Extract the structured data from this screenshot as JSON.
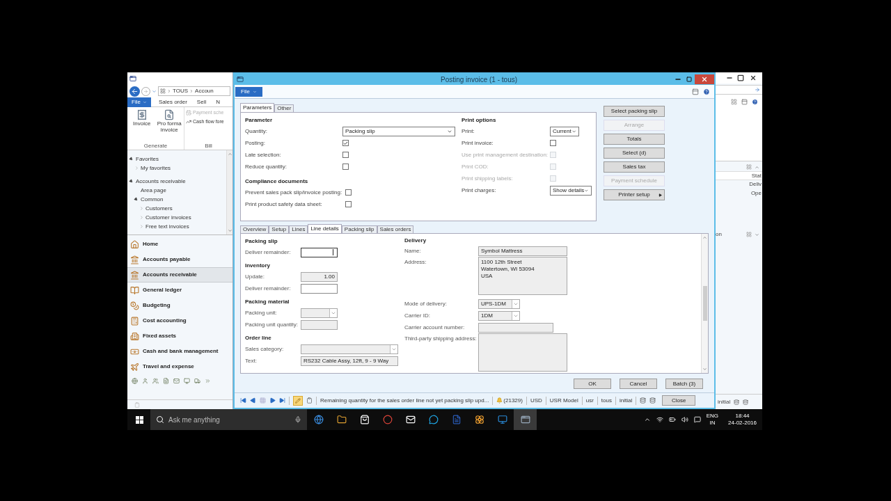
{
  "left_window": {
    "breadcrumb": [
      "TOUS",
      "Accoun"
    ],
    "file_menu": "File",
    "ribbon_tabs": [
      "Sales order",
      "Sell",
      "N"
    ],
    "generate_group": {
      "label": "Generate",
      "buttons": [
        "Invoice",
        "Pro forma invoice"
      ]
    },
    "bill_group": {
      "label": "Bill",
      "items": [
        {
          "label": "Payment sche",
          "disabled": true
        },
        {
          "label": "Cash flow fore",
          "disabled": false
        }
      ]
    },
    "nav_tree": [
      {
        "label": "Favorites",
        "expanded": true,
        "children": [
          {
            "label": "My favorites",
            "expanded": false
          }
        ]
      },
      {
        "label": "Accounts receivable",
        "expanded": true,
        "children": [
          {
            "label": "Area page"
          },
          {
            "label": "Common",
            "expanded": true,
            "children": [
              {
                "label": "Customers",
                "expanded": false
              },
              {
                "label": "Customer invoices",
                "expanded": false
              },
              {
                "label": "Free text invoices",
                "expanded": false
              }
            ]
          }
        ]
      }
    ],
    "modules": [
      {
        "label": "Home",
        "selected": false
      },
      {
        "label": "Accounts payable",
        "selected": false
      },
      {
        "label": "Accounts receivable",
        "selected": true
      },
      {
        "label": "General ledger",
        "selected": false
      },
      {
        "label": "Budgeting",
        "selected": false
      },
      {
        "label": "Cost accounting",
        "selected": false
      },
      {
        "label": "Fixed assets",
        "selected": false
      },
      {
        "label": "Cash and bank management",
        "selected": false
      },
      {
        "label": "Travel and expense",
        "selected": false
      }
    ]
  },
  "dialog": {
    "title": "Posting invoice (1 - tous)",
    "file_menu": "File",
    "top_tabs": [
      {
        "label": "Parameters",
        "selected": true
      },
      {
        "label": "Other",
        "selected": false
      }
    ],
    "parameter": {
      "heading": "Parameter",
      "fields": [
        {
          "kind": "dropdown",
          "label": "Quantity:",
          "value": "Packing slip"
        },
        {
          "kind": "checkbox",
          "label": "Posting:",
          "checked": true
        },
        {
          "kind": "checkbox",
          "label": "Late selection:",
          "checked": false
        },
        {
          "kind": "checkbox",
          "label": "Reduce quantity:",
          "checked": false
        }
      ]
    },
    "compliance": {
      "heading": "Compliance documents",
      "fields": [
        {
          "kind": "checkbox",
          "label": "Prevent sales pack slip/invoice posting:",
          "checked": false
        },
        {
          "kind": "checkbox",
          "label": "Print product safety data sheet:",
          "checked": false
        }
      ]
    },
    "print_options": {
      "heading": "Print options",
      "fields": [
        {
          "kind": "dropdown",
          "label": "Print:",
          "value": "Current"
        },
        {
          "kind": "checkbox",
          "label": "Print invoice:",
          "checked": false,
          "disabled": false
        },
        {
          "kind": "checkbox",
          "label": "Use print management destination:",
          "checked": false,
          "disabled": true
        },
        {
          "kind": "checkbox",
          "label": "Print COD:",
          "checked": false,
          "disabled": true
        },
        {
          "kind": "checkbox",
          "label": "Print shipping labels:",
          "checked": false,
          "disabled": true
        },
        {
          "kind": "dropdown",
          "label": "Print charges:",
          "value": "Show details"
        }
      ]
    },
    "actions": [
      {
        "label": "Select packing slip",
        "disabled": false,
        "submenu": false
      },
      {
        "label": "Arrange",
        "disabled": true,
        "submenu": false
      },
      {
        "label": "Totals",
        "disabled": false,
        "submenu": false
      },
      {
        "label": "Select (d)",
        "disabled": false,
        "submenu": false
      },
      {
        "label": "Sales tax",
        "disabled": false,
        "submenu": false
      },
      {
        "label": "Payment schedule",
        "disabled": true,
        "submenu": false
      },
      {
        "label": "Printer setup",
        "disabled": false,
        "submenu": true
      }
    ],
    "detail_tabs": [
      {
        "label": "Overview",
        "selected": false
      },
      {
        "label": "Setup",
        "selected": false
      },
      {
        "label": "Lines",
        "selected": false
      },
      {
        "label": "Line details",
        "selected": true
      },
      {
        "label": "Packing slip",
        "selected": false
      },
      {
        "label": "Sales orders",
        "selected": false
      }
    ],
    "line_details": {
      "sections": [
        {
          "heading": "Packing slip",
          "fields": [
            {
              "kind": "input",
              "label": "Deliver remainder:",
              "readonly": false,
              "focused": true
            }
          ]
        },
        {
          "heading": "Inventory",
          "fields": [
            {
              "kind": "number",
              "label": "Update:",
              "value": "1.00",
              "readonly": true
            },
            {
              "kind": "input",
              "label": "Deliver remainder:",
              "readonly": false,
              "focused": false
            }
          ]
        },
        {
          "heading": "Packing material",
          "fields": [
            {
              "kind": "dropdown",
              "label": "Packing unit:",
              "readonly": true
            },
            {
              "kind": "input",
              "label": "Packing unit quantity:",
              "readonly": true,
              "focused": false
            }
          ]
        },
        {
          "heading": "Order line",
          "fields": [
            {
              "kind": "dropdown",
              "label": "Sales category:",
              "readonly": true,
              "wide": true
            },
            {
              "kind": "input",
              "label": "Text:",
              "value": "RS232 Cable Assy, 12ft, 9 - 9 Way",
              "readonly": true,
              "focused": false,
              "wide": true
            }
          ]
        }
      ]
    },
    "delivery": {
      "heading": "Delivery",
      "fields": [
        {
          "kind": "input",
          "label": "Name:",
          "value": "Symbol Mattress",
          "readonly": true,
          "focused": false
        },
        {
          "kind": "textarea",
          "label": "Address:",
          "lines": [
            "1100 12th Street",
            "Watertown, WI 53094",
            "USA"
          ]
        },
        {
          "kind": "dropdown",
          "label": "Mode of delivery:",
          "value": "UPS-1DM",
          "readonly": true
        },
        {
          "kind": "dropdown",
          "label": "Carrier ID:",
          "value": "1DM",
          "readonly": true
        },
        {
          "kind": "input",
          "label": "Carrier account number:",
          "readonly": true,
          "focused": false
        },
        {
          "kind": "textarea",
          "label": "Third-party shipping address:"
        }
      ]
    },
    "footer_buttons": [
      "OK",
      "Cancel",
      "Batch (3)"
    ],
    "status_bar": {
      "message": "Remaining quantity for the sales order line not yet packing slip upd...",
      "notifications": "(21329)",
      "segments": [
        "USD",
        "USR Model",
        "usr",
        "tous",
        "initial"
      ],
      "close": "Close"
    }
  },
  "right_window": {
    "column_header": "Stat",
    "cells": [
      "Deliv",
      "Ope"
    ],
    "group_label": "on",
    "status": "initial"
  },
  "taskbar": {
    "search_placeholder": "Ask me anything",
    "language": "ENG",
    "region": "IN",
    "time": "18:44",
    "date": "24-02-2016"
  }
}
